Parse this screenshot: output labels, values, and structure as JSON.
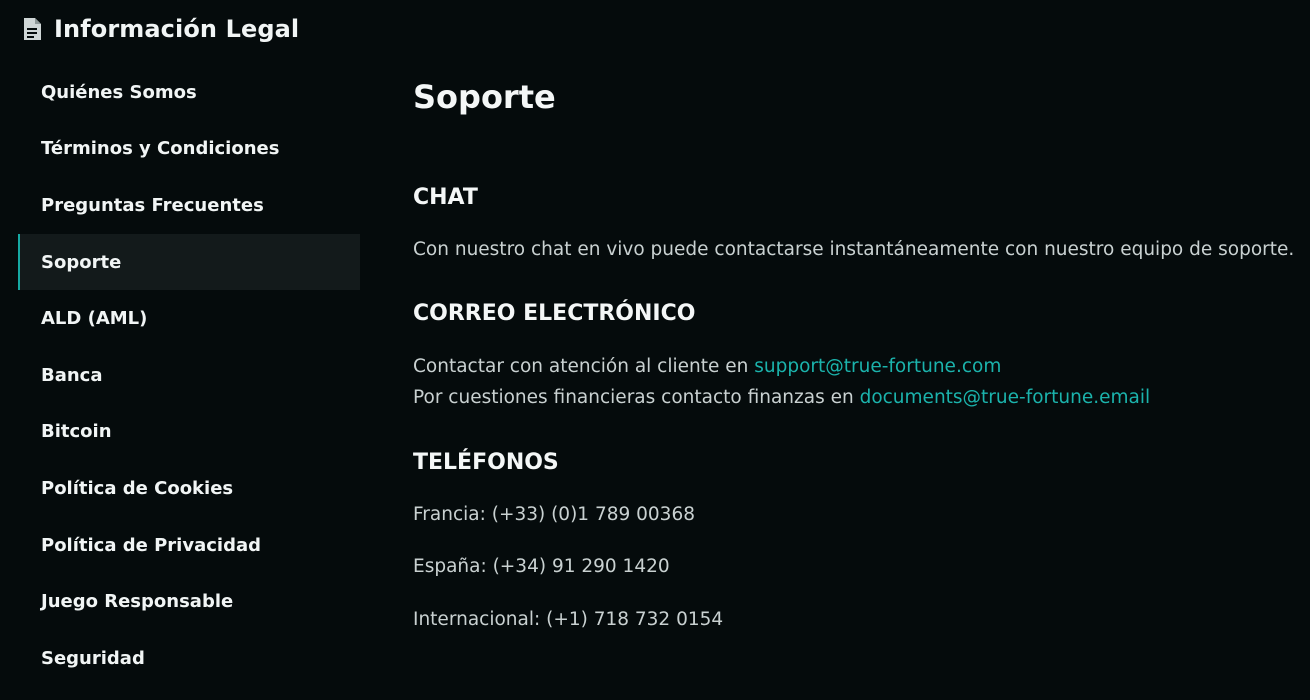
{
  "header": {
    "icon": "document-icon",
    "title": "Información Legal"
  },
  "sidebar": {
    "active_item": "Soporte",
    "accent_color": "#16a9a3",
    "items": [
      {
        "label": "Quiénes Somos"
      },
      {
        "label": "Términos y Condiciones"
      },
      {
        "label": "Preguntas Frecuentes"
      },
      {
        "label": "Soporte"
      },
      {
        "label": "ALD (AML)"
      },
      {
        "label": "Banca"
      },
      {
        "label": "Bitcoin"
      },
      {
        "label": "Política de Cookies"
      },
      {
        "label": "Política de Privacidad"
      },
      {
        "label": "Juego Responsable"
      },
      {
        "label": "Seguridad"
      }
    ]
  },
  "main": {
    "title": "Soporte",
    "chat": {
      "heading": "CHAT",
      "text": "Con nuestro chat en vivo puede contactarse instantáneamente con nuestro equipo de soporte."
    },
    "email": {
      "heading": "CORREO ELECTRÓNICO",
      "line1_text": "Contactar con atención al cliente en ",
      "line1_link": "support@true-fortune.com",
      "line2_text": "Por cuestiones financieras contacto finanzas en ",
      "line2_link": "documents@true-fortune.email"
    },
    "phones": {
      "heading": "TELÉFONOS",
      "france": "Francia: (+33) (0)1 789 00368",
      "spain": "España: (+34) 91 290 1420",
      "international": "Internacional: (+1) 718 732 0154"
    }
  }
}
